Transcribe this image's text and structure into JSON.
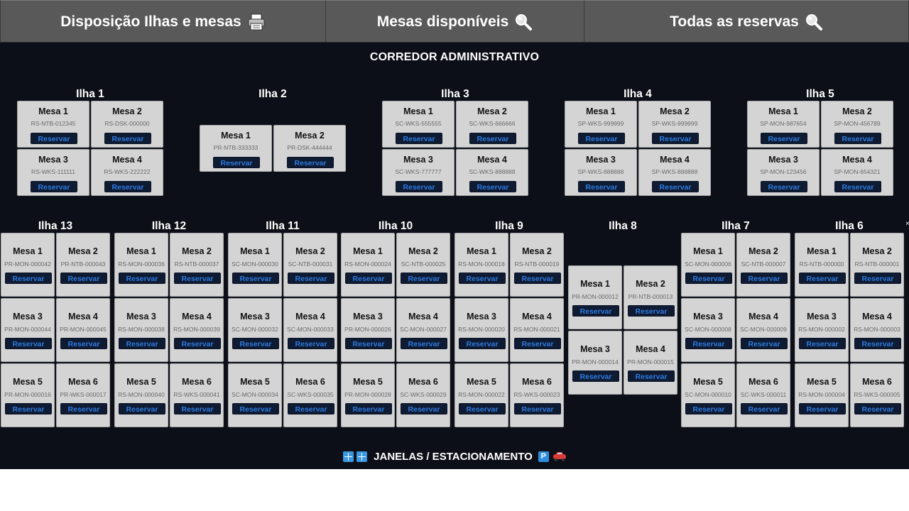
{
  "tabs": [
    {
      "label": "Disposição Ilhas e mesas",
      "icon": "printer-icon"
    },
    {
      "label": "Mesas disponíveis",
      "icon": "search-icon"
    },
    {
      "label": "Todas as reservas",
      "icon": "search-icon"
    }
  ],
  "header": {
    "corridor": "CORREDOR ADMINISTRATIVO"
  },
  "footer": {
    "label": "JANELAS / ESTACIONAMENTO",
    "icons": [
      "window-icon",
      "window-icon",
      "parking-icon",
      "car-icon"
    ]
  },
  "reserve_label": "Reservar",
  "colors": {
    "background": "#0c0f17",
    "tab_bar": "#595959",
    "desk": "#d4d4d4",
    "button": "#0f1b33",
    "button_text": "#2d7be0"
  },
  "islands": [
    {
      "id": 1,
      "name": "Ilha 1",
      "desks": [
        {
          "name": "Mesa 1",
          "code": "RS-NTB-012345"
        },
        {
          "name": "Mesa 2",
          "code": "RS-DSK-000000"
        },
        {
          "name": "Mesa 3",
          "code": "RS-WKS-111111"
        },
        {
          "name": "Mesa 4",
          "code": "RS-WKS-222222"
        }
      ]
    },
    {
      "id": 2,
      "name": "Ilha 2",
      "desks": [
        {
          "name": "Mesa 1",
          "code": "PR-NTB-333333"
        },
        {
          "name": "Mesa 2",
          "code": "PR-DSK-444444"
        }
      ]
    },
    {
      "id": 3,
      "name": "Ilha 3",
      "desks": [
        {
          "name": "Mesa 1",
          "code": "SC-WKS-555555"
        },
        {
          "name": "Mesa 2",
          "code": "SC-WKS-666666"
        },
        {
          "name": "Mesa 3",
          "code": "SC-WKS-777777"
        },
        {
          "name": "Mesa 4",
          "code": "SC-WKS-888888"
        }
      ]
    },
    {
      "id": 4,
      "name": "Ilha 4",
      "desks": [
        {
          "name": "Mesa 1",
          "code": "SP-WKS-999999"
        },
        {
          "name": "Mesa 2",
          "code": "SP-WKS-999999"
        },
        {
          "name": "Mesa 3",
          "code": "SP-WKS-888888"
        },
        {
          "name": "Mesa 4",
          "code": "SP-WKS-888888"
        }
      ]
    },
    {
      "id": 5,
      "name": "Ilha 5",
      "desks": [
        {
          "name": "Mesa 1",
          "code": "SP-MON-987654"
        },
        {
          "name": "Mesa 2",
          "code": "SP-MON-456789"
        },
        {
          "name": "Mesa 3",
          "code": "SP-MON-123456"
        },
        {
          "name": "Mesa 4",
          "code": "SP-MON-654321"
        }
      ]
    },
    {
      "id": 13,
      "name": "Ilha 13",
      "desks": [
        {
          "name": "Mesa 1",
          "code": "PR-MON-000042"
        },
        {
          "name": "Mesa 2",
          "code": "PR-NTB-000043"
        },
        {
          "name": "Mesa 3",
          "code": "PR-MON-000044"
        },
        {
          "name": "Mesa 4",
          "code": "PR-MON-000045"
        },
        {
          "name": "Mesa 5",
          "code": "PR-MON-000016"
        },
        {
          "name": "Mesa 6",
          "code": "PR-WKS-000017"
        }
      ]
    },
    {
      "id": 12,
      "name": "Ilha 12",
      "desks": [
        {
          "name": "Mesa 1",
          "code": "RS-MON-000036"
        },
        {
          "name": "Mesa 2",
          "code": "RS-NTB-000037"
        },
        {
          "name": "Mesa 3",
          "code": "RS-MON-000038"
        },
        {
          "name": "Mesa 4",
          "code": "RS-MON-000039"
        },
        {
          "name": "Mesa 5",
          "code": "RS-MON-000040"
        },
        {
          "name": "Mesa 6",
          "code": "RS-WKS-000041"
        }
      ]
    },
    {
      "id": 11,
      "name": "Ilha 11",
      "desks": [
        {
          "name": "Mesa 1",
          "code": "SC-MON-000030"
        },
        {
          "name": "Mesa 2",
          "code": "SC-NTB-000031"
        },
        {
          "name": "Mesa 3",
          "code": "SC-MON-000032"
        },
        {
          "name": "Mesa 4",
          "code": "SC-MON-000033"
        },
        {
          "name": "Mesa 5",
          "code": "SC-MON-000034"
        },
        {
          "name": "Mesa 6",
          "code": "SC-WKS-000035"
        }
      ]
    },
    {
      "id": 10,
      "name": "Ilha 10",
      "desks": [
        {
          "name": "Mesa 1",
          "code": "RS-MON-000024"
        },
        {
          "name": "Mesa 2",
          "code": "SC-NTB-000025"
        },
        {
          "name": "Mesa 3",
          "code": "PR-MON-000026"
        },
        {
          "name": "Mesa 4",
          "code": "SC-MON-000027"
        },
        {
          "name": "Mesa 5",
          "code": "PR-MON-000028"
        },
        {
          "name": "Mesa 6",
          "code": "SC-WKS-000029"
        }
      ]
    },
    {
      "id": 9,
      "name": "Ilha 9",
      "desks": [
        {
          "name": "Mesa 1",
          "code": "RS-MON-000018"
        },
        {
          "name": "Mesa 2",
          "code": "RS-NTB-000019"
        },
        {
          "name": "Mesa 3",
          "code": "RS-MON-000020"
        },
        {
          "name": "Mesa 4",
          "code": "RS-MON-000021"
        },
        {
          "name": "Mesa 5",
          "code": "RS-MON-000022"
        },
        {
          "name": "Mesa 6",
          "code": "RS-WKS-000023"
        }
      ]
    },
    {
      "id": 8,
      "name": "Ilha 8",
      "desks": [
        {
          "name": "Mesa 1",
          "code": "PR-MON-000012"
        },
        {
          "name": "Mesa 2",
          "code": "PR-NTB-000013"
        },
        {
          "name": "Mesa 3",
          "code": "PR-MON-000014"
        },
        {
          "name": "Mesa 4",
          "code": "PR-MON-000015"
        }
      ]
    },
    {
      "id": 7,
      "name": "Ilha 7",
      "desks": [
        {
          "name": "Mesa 1",
          "code": "SC-MON-000006"
        },
        {
          "name": "Mesa 2",
          "code": "SC-NTB-000007"
        },
        {
          "name": "Mesa 3",
          "code": "SC-MON-000008"
        },
        {
          "name": "Mesa 4",
          "code": "SC-MON-000009"
        },
        {
          "name": "Mesa 5",
          "code": "SC-MON-000010"
        },
        {
          "name": "Mesa 6",
          "code": "SC-WKS-000011"
        }
      ]
    },
    {
      "id": 6,
      "name": "Ilha 6",
      "desks": [
        {
          "name": "Mesa 1",
          "code": "RS-NTB-000000"
        },
        {
          "name": "Mesa 2",
          "code": "RS-NTB-000001"
        },
        {
          "name": "Mesa 3",
          "code": "RS-MON-000002"
        },
        {
          "name": "Mesa 4",
          "code": "RS-MON-000003"
        },
        {
          "name": "Mesa 5",
          "code": "RS-MON-000004"
        },
        {
          "name": "Mesa 6",
          "code": "RS-WKS-000005"
        }
      ]
    }
  ]
}
